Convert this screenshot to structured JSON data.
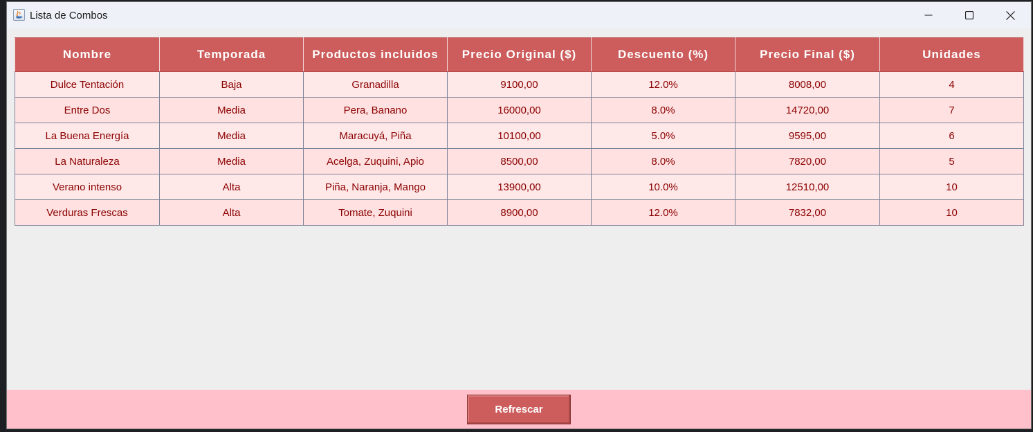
{
  "window": {
    "title": "Lista de Combos"
  },
  "table": {
    "columns": [
      "Nombre",
      "Temporada",
      "Productos incluidos",
      "Precio Original ($)",
      "Descuento (%)",
      "Precio Final ($)",
      "Unidades"
    ],
    "rows": [
      [
        "Dulce Tentación",
        "Baja",
        "Granadilla",
        "9100,00",
        "12.0%",
        "8008,00",
        "4"
      ],
      [
        "Entre Dos",
        "Media",
        "Pera, Banano",
        "16000,00",
        "8.0%",
        "14720,00",
        "7"
      ],
      [
        "La Buena Energía",
        "Media",
        "Maracuyá, Piña",
        "10100,00",
        "5.0%",
        "9595,00",
        "6"
      ],
      [
        "La Naturaleza",
        "Media",
        "Acelga, Zuquini, Apio",
        "8500,00",
        "8.0%",
        "7820,00",
        "5"
      ],
      [
        "Verano intenso",
        "Alta",
        "Piña, Naranja, Mango",
        "13900,00",
        "10.0%",
        "12510,00",
        "10"
      ],
      [
        "Verduras Frescas",
        "Alta",
        "Tomate, Zuquini",
        "8900,00",
        "12.0%",
        "7832,00",
        "10"
      ]
    ]
  },
  "footer": {
    "refresh_label": "Refrescar"
  },
  "colors": {
    "header_bg": "#cd5c5c",
    "row_bg_odd": "#ffe8e8",
    "row_bg_even": "#ffe1e1",
    "cell_text": "#8b0000",
    "footer_bg": "#ffc0cb",
    "button_bg": "#cd5c5c"
  },
  "icons": {
    "app": "java-app-icon",
    "minimize": "minimize-icon",
    "maximize": "maximize-icon",
    "close": "close-icon"
  }
}
